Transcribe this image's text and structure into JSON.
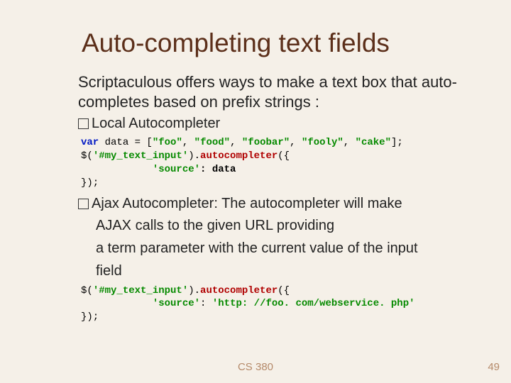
{
  "title": "Auto-completing text fields",
  "intro": "Scriptaculous offers ways to make a text box that auto-completes based on prefix strings :",
  "bullet1": "Local Autocompleter",
  "code1": {
    "l1a": "var",
    "l1b": " data = [",
    "l1c": "\"foo\"",
    "l1d": ", ",
    "l1e": "\"food\"",
    "l1f": ", ",
    "l1g": "\"foobar\"",
    "l1h": ", ",
    "l1i": "\"fooly\"",
    "l1j": ", ",
    "l1k": "\"cake\"",
    "l1l": "];",
    "l2a": "$(",
    "l2b": "'#my_text_input'",
    "l2c": ").",
    "l2d": "autocompleter",
    "l2e": "({",
    "l3a": "            ",
    "l3b": "'source'",
    "l3c": ": data",
    "l4": "});"
  },
  "bullet2_lead": "Ajax Autocompleter: ",
  "bullet2_rest": "The autocompleter will make",
  "bullet2_cont": "AJAX calls to the given URL providing\na term parameter with the current value of the input field",
  "bullet2_c1": "AJAX calls to the given URL providing",
  "bullet2_c2": "a term parameter with the current value of the input",
  "bullet2_c3": "field",
  "code2": {
    "l1a": "$(",
    "l1b": "'#my_text_input'",
    "l1c": ").",
    "l1d": "autocompleter",
    "l1e": "({",
    "l2a": "            ",
    "l2b": "'source'",
    "l2c": ": ",
    "l2d": "'http: //foo. com/webservice. php'",
    "l3": "});"
  },
  "footer": "CS 380",
  "page": "49"
}
